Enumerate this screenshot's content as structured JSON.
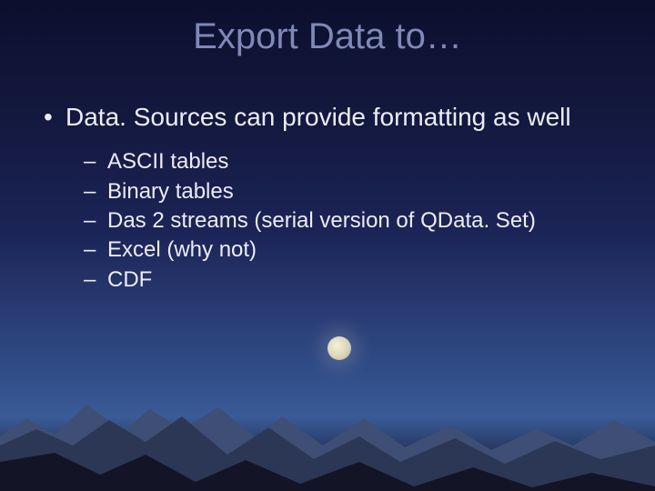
{
  "title": "Export Data to…",
  "bullets": [
    {
      "text": "Data. Sources can provide formatting as well",
      "sub": [
        "ASCII tables",
        "Binary tables",
        "Das 2 streams (serial version of QData. Set)",
        "Excel (why not)",
        "CDF"
      ]
    }
  ],
  "theme": {
    "title_color": "#7f89b5",
    "text_color": "#ecedf3",
    "background_top": "#0c0f2d",
    "background_bottom": "#0b0b20"
  }
}
